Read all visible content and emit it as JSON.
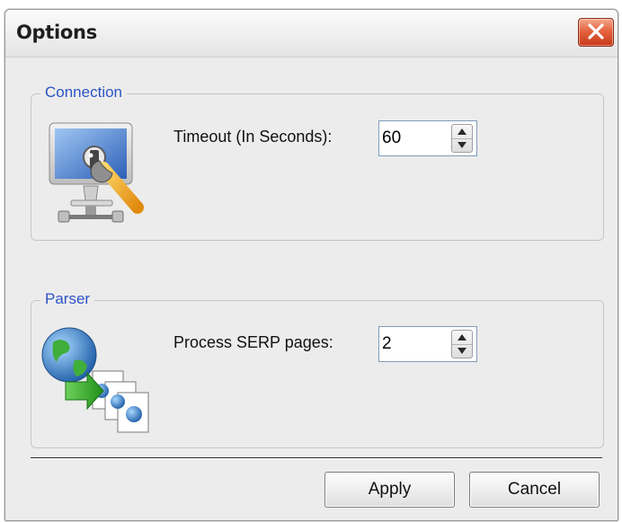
{
  "window": {
    "title": "Options",
    "close_icon": "close-icon"
  },
  "connection": {
    "legend": "Connection",
    "icon": "computer-network-settings-icon",
    "timeout_label": "Timeout (In Seconds):",
    "timeout_value": "60"
  },
  "parser": {
    "legend": "Parser",
    "icon": "globe-pages-icon",
    "pages_label": "Process SERP  pages:",
    "pages_value": "2"
  },
  "buttons": {
    "apply": "Apply",
    "cancel": "Cancel"
  },
  "colors": {
    "group_legend": "#2b54c6",
    "close_button": "#d9532c"
  }
}
